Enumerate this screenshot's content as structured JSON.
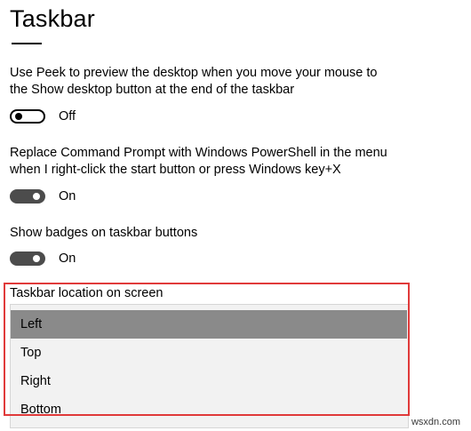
{
  "page": {
    "title": "Taskbar"
  },
  "settings": [
    {
      "description_line1": "Use Peek to preview the desktop when you move your mouse to",
      "description_line2": "the Show desktop button at the end of the taskbar",
      "state_label": "Off",
      "checked": false
    },
    {
      "description_line1": "Replace Command Prompt with Windows PowerShell in the menu",
      "description_line2": "when I right-click the start button or press Windows key+X",
      "state_label": "On",
      "checked": true
    },
    {
      "description_line1": "Show badges on taskbar buttons",
      "state_label": "On",
      "checked": true
    }
  ],
  "location": {
    "label": "Taskbar location on screen",
    "options": [
      "Left",
      "Top",
      "Right",
      "Bottom"
    ],
    "selected": "Left"
  },
  "watermark": "wsxdn.com",
  "colors": {
    "highlight_border": "#e03a3a",
    "selected_option_bg": "#8a8a8a",
    "toggle_on": "#4c4c4c"
  }
}
